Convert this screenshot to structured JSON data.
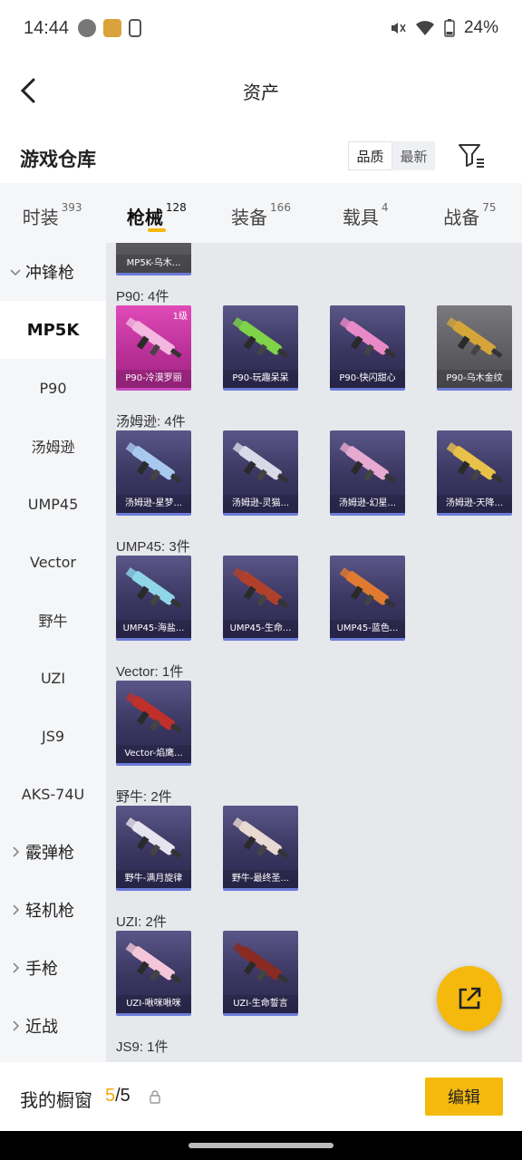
{
  "status_bar": {
    "time": "14:44",
    "battery": "24%"
  },
  "header": {
    "title": "资产"
  },
  "warehouse": {
    "title": "游戏仓库",
    "sort_options": [
      "品质",
      "最新"
    ],
    "sort_active": "品质"
  },
  "tabs": [
    {
      "label": "时装",
      "count": "393"
    },
    {
      "label": "枪械",
      "count": "128",
      "active": true
    },
    {
      "label": "装备",
      "count": "166"
    },
    {
      "label": "载具",
      "count": "4"
    },
    {
      "label": "战备",
      "count": "75"
    }
  ],
  "sidebar": {
    "items": [
      {
        "label": "冲锋枪",
        "type": "category",
        "expanded": true
      },
      {
        "label": "MP5K",
        "active": true
      },
      {
        "label": "P90"
      },
      {
        "label": "汤姆逊"
      },
      {
        "label": "UMP45"
      },
      {
        "label": "Vector"
      },
      {
        "label": "野牛"
      },
      {
        "label": "UZI"
      },
      {
        "label": "JS9"
      },
      {
        "label": "AKS-74U"
      },
      {
        "label": "霰弹枪",
        "type": "category"
      },
      {
        "label": "轻机枪",
        "type": "category"
      },
      {
        "label": "手枪",
        "type": "category"
      },
      {
        "label": "近战",
        "type": "category"
      }
    ]
  },
  "inventory": {
    "partial_top_item": "MP5K-乌木...",
    "groups": [
      {
        "label": "P90: 4件",
        "items": [
          {
            "name": "P90-冷漠罗丽",
            "level": "1级",
            "style": "pink",
            "color": "#f3b7e0"
          },
          {
            "name": "P90-玩趣呆呆",
            "style": "purple",
            "color": "#7ed348"
          },
          {
            "name": "P90-快闪甜心",
            "style": "purple",
            "color": "#e98ac8"
          },
          {
            "name": "P90-乌木金纹",
            "style": "gray",
            "color": "#d6a53a"
          }
        ]
      },
      {
        "label": "汤姆逊: 4件",
        "items": [
          {
            "name": "汤姆逊-星梦...",
            "style": "purple",
            "color": "#a9c8f0"
          },
          {
            "name": "汤姆逊-灵猫...",
            "style": "purple",
            "color": "#d9d9e8"
          },
          {
            "name": "汤姆逊-幻星...",
            "style": "purple",
            "color": "#e6a9d0"
          },
          {
            "name": "汤姆逊-天降...",
            "style": "purple",
            "color": "#e7c14a"
          }
        ]
      },
      {
        "label": "UMP45: 3件",
        "items": [
          {
            "name": "UMP45-海盐...",
            "style": "purple",
            "color": "#8fd6e8"
          },
          {
            "name": "UMP45-生命...",
            "style": "purple",
            "color": "#b0402c"
          },
          {
            "name": "UMP45-蓝色...",
            "style": "purple",
            "color": "#e07a30"
          }
        ]
      },
      {
        "label": "Vector: 1件",
        "items": [
          {
            "name": "Vector-焰鹰...",
            "style": "purple",
            "color": "#c0302a"
          }
        ]
      },
      {
        "label": "野牛: 2件",
        "items": [
          {
            "name": "野牛-满月旋律",
            "style": "purple",
            "color": "#e8e4ef"
          },
          {
            "name": "野牛-最终圣...",
            "style": "purple",
            "color": "#e8d9d2"
          }
        ]
      },
      {
        "label": "UZI: 2件",
        "items": [
          {
            "name": "UZI-啾咪啾咪",
            "style": "purple",
            "color": "#f3c6d8"
          },
          {
            "name": "UZI-生命誓言",
            "style": "purple",
            "color": "#8a2a22"
          }
        ]
      },
      {
        "label": "JS9: 1件",
        "items": []
      }
    ]
  },
  "bottom_bar": {
    "label": "我的橱窗",
    "current": "5",
    "total": "/5",
    "edit_label": "编辑"
  },
  "colors": {
    "accent": "#f5b90d",
    "sidebar_bg": "#f5f6f8",
    "content_bg": "#e6e8ec"
  }
}
